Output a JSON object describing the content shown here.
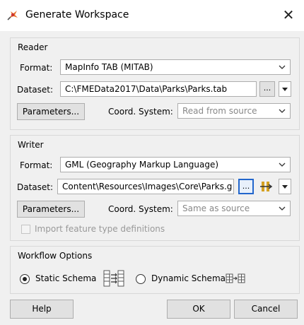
{
  "window": {
    "title": "Generate Workspace",
    "close_glyph": "✕"
  },
  "reader": {
    "group_title": "Reader",
    "format_label": "Format:",
    "format_value": "MapInfo TAB (MITAB)",
    "dataset_label": "Dataset:",
    "dataset_value": "C:\\FMEData2017\\Data\\Parks\\Parks.tab",
    "browse_label": "...",
    "parameters_label": "Parameters...",
    "coord_label": "Coord. System:",
    "coord_value": "Read from source"
  },
  "writer": {
    "group_title": "Writer",
    "format_label": "Format:",
    "format_value": "GML (Geography Markup Language)",
    "dataset_label": "Dataset:",
    "dataset_value": "Content\\Resources\\Images\\Core\\Parks.gml",
    "browse_label": "...",
    "parameters_label": "Parameters...",
    "coord_label": "Coord. System:",
    "coord_value": "Same as source",
    "import_label": "Import feature type definitions",
    "import_checked": false
  },
  "workflow": {
    "group_title": "Workflow Options",
    "static_label": "Static Schema",
    "dynamic_label": "Dynamic Schema",
    "selected": "static"
  },
  "buttons": {
    "help": "Help",
    "ok": "OK",
    "cancel": "Cancel"
  },
  "icons": {
    "app": "fme-workbench-icon",
    "static_schema": "static-schema-icon",
    "dynamic_schema": "dynamic-schema-icon",
    "arrow": "chevron-down-icon"
  },
  "colors": {
    "window_bg": "#f0f0f0",
    "selection_accent": "#2266cc"
  }
}
